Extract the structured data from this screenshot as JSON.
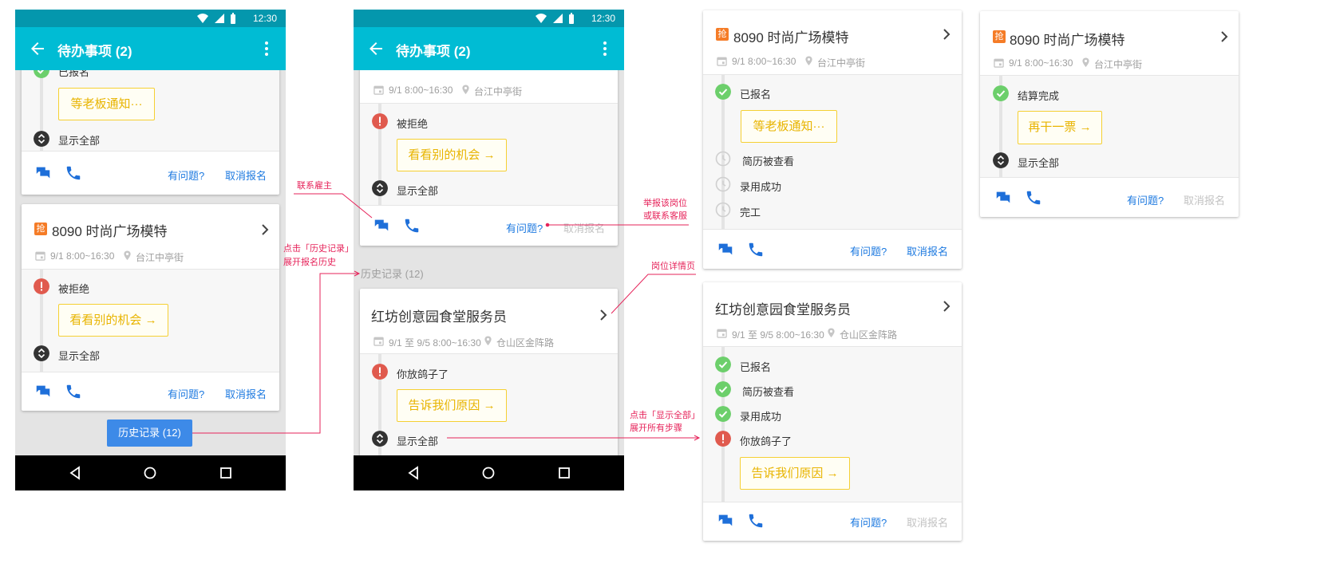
{
  "status_bar": {
    "time": "12:30"
  },
  "app_bar": {
    "title": "待办事项 (2)"
  },
  "common": {
    "show_all": "显示全部",
    "have_question": "有问题?",
    "cancel_signup": "取消报名",
    "grab_badge": "抢"
  },
  "jobs": {
    "fashion": {
      "title": "8090 时尚广场模特",
      "date": "9/1 8:00~16:30",
      "location": "台江中亭街"
    },
    "canteen": {
      "title": "红坊创意园食堂服务员",
      "date": "9/1 至 9/5 8:00~16:30",
      "location": "仓山区金阵路"
    }
  },
  "steps": {
    "signed": "已报名",
    "rejected": "被拒绝",
    "stood_up": "你放鸽子了",
    "resume_viewed": "简历被查看",
    "hired": "录用成功",
    "finished": "完工",
    "settled": "结算完成"
  },
  "actions": {
    "wait_boss": "等老板通知···",
    "other_chances": "看看别的机会 →",
    "tell_reason": "告诉我们原因 →",
    "again": "再干一票 →"
  },
  "history": {
    "button": "历史记录 (12)",
    "section": "历史记录 (12)"
  },
  "annotations": {
    "contact_employer": "联系雇主",
    "report_line1": "举报该岗位",
    "report_line2": "或联系客服",
    "history_line1": "点击「历史记录」",
    "history_line2": "展开报名历史",
    "job_detail": "岗位详情页",
    "showall_line1": "点击「显示全部」",
    "showall_line2": "展开所有步骤"
  },
  "colors": {
    "appbar": "#00bcd4",
    "statusbar": "#0497ad",
    "link": "#1e7ae0",
    "action_yellow": "#e8b400",
    "success_green": "#6ccf6b",
    "error_red": "#e05a4e",
    "annotation": "#e6235a",
    "history_button": "#3d8ae8"
  }
}
